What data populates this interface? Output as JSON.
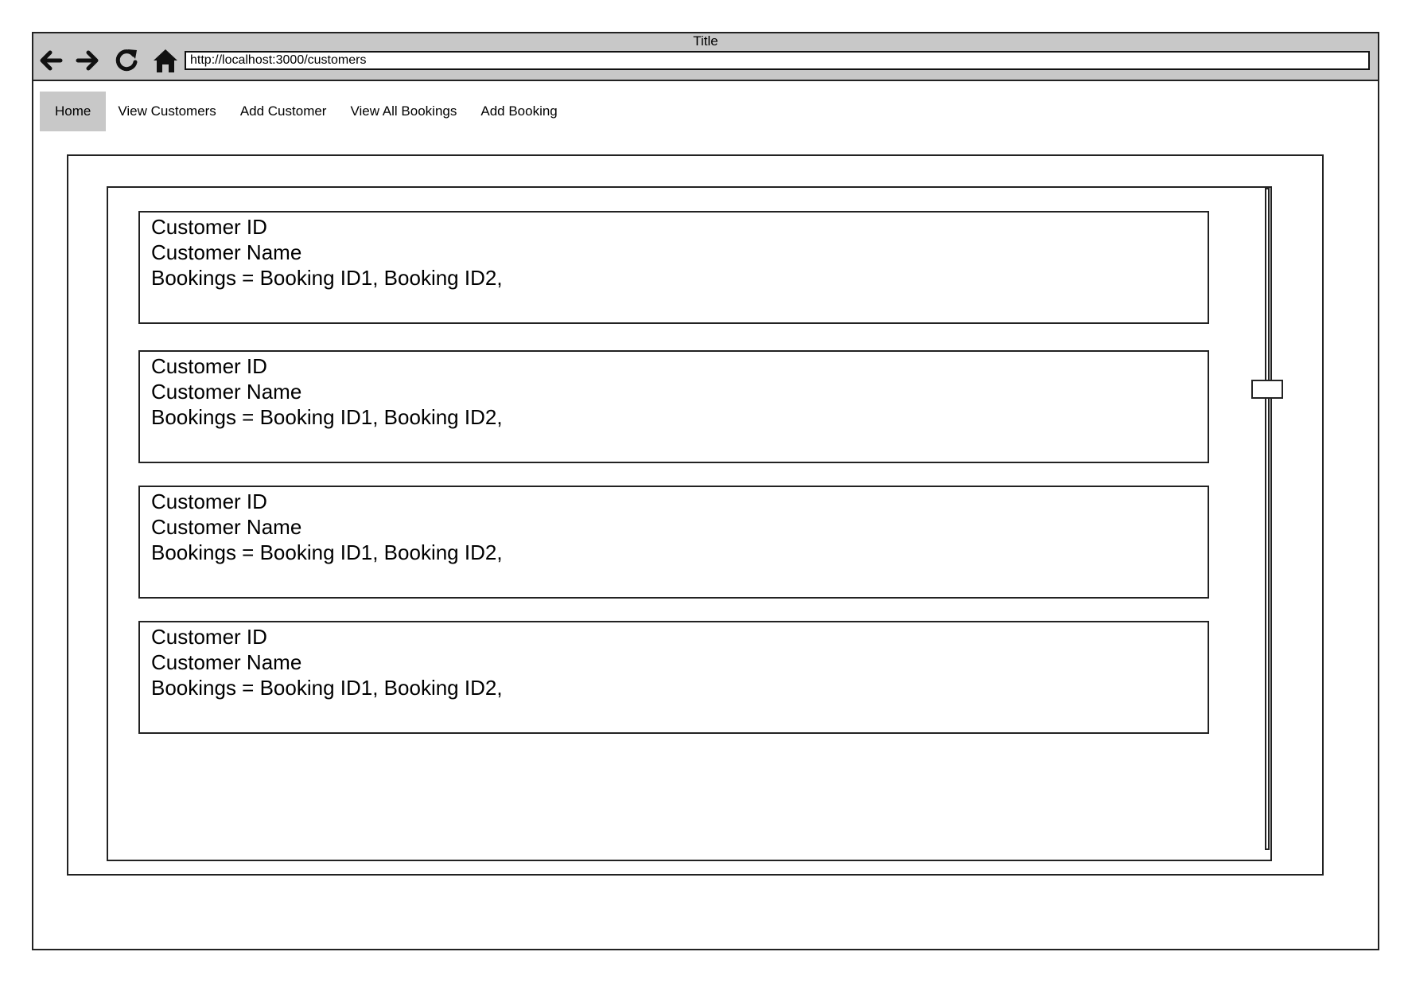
{
  "window": {
    "title": "Title"
  },
  "browser": {
    "url": "http://localhost:3000/customers",
    "buttons": {
      "back_icon": "left-arrow",
      "forward_icon": "right-arrow",
      "reload_icon": "reload",
      "home_icon": "home"
    }
  },
  "menu": {
    "items": [
      {
        "label": "Home",
        "active": true
      },
      {
        "label": "View Customers",
        "active": false
      },
      {
        "label": "Add Customer",
        "active": false
      },
      {
        "label": "View All Bookings",
        "active": false
      },
      {
        "label": "Add Booking",
        "active": false
      }
    ]
  },
  "customers": [
    {
      "id_label": "Customer ID",
      "name_label": "Customer Name",
      "bookings_label": "Bookings =  Booking ID1, Booking ID2,"
    },
    {
      "id_label": "Customer ID",
      "name_label": "Customer Name",
      "bookings_label": "Bookings =  Booking ID1, Booking ID2,"
    },
    {
      "id_label": "Customer ID",
      "name_label": "Customer Name",
      "bookings_label": "Bookings =  Booking ID1, Booking ID2,"
    },
    {
      "id_label": "Customer ID",
      "name_label": "Customer Name",
      "bookings_label": "Bookings =  Booking ID1, Booking ID2,"
    }
  ],
  "colors": {
    "chrome": "#c8c8c8",
    "active_tab": "#c8c8c8",
    "border": "#222222"
  }
}
